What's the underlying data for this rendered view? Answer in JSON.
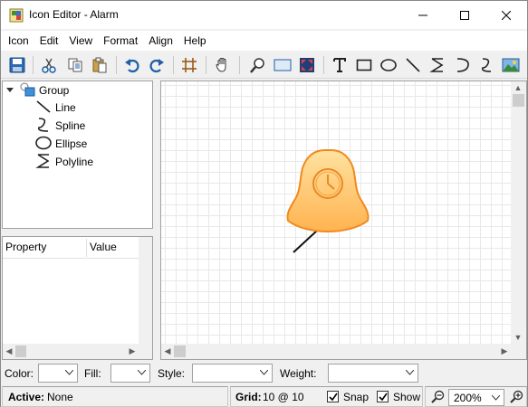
{
  "window": {
    "title": "Icon Editor - Alarm",
    "minimize_label": "Minimize",
    "maximize_label": "Maximize",
    "close_label": "Close"
  },
  "menu": {
    "items": [
      {
        "label": "Icon"
      },
      {
        "label": "Edit"
      },
      {
        "label": "View"
      },
      {
        "label": "Format"
      },
      {
        "label": "Align"
      },
      {
        "label": "Help"
      }
    ]
  },
  "toolbar": {
    "tools": [
      "save-icon",
      "cut-icon",
      "copy-icon",
      "paste-icon",
      "undo-icon",
      "redo-icon",
      "grid-icon",
      "pan-hand-icon",
      "zoom-icon",
      "select-rect-icon",
      "fit-icon",
      "text-icon",
      "rectangle-icon",
      "ellipse-icon",
      "line-icon",
      "polyline-icon",
      "arc-icon",
      "spline-icon",
      "image-icon"
    ]
  },
  "tree": {
    "root": {
      "label": "Group",
      "icon": "group-icon"
    },
    "children": [
      {
        "label": "Line",
        "icon": "line-shape-icon"
      },
      {
        "label": "Spline",
        "icon": "spline-shape-icon"
      },
      {
        "label": "Ellipse",
        "icon": "ellipse-shape-icon"
      },
      {
        "label": "Polyline",
        "icon": "polyline-shape-icon"
      }
    ]
  },
  "properties": {
    "col_property": "Property",
    "col_value": "Value"
  },
  "propbar": {
    "color_label": "Color:",
    "fill_label": "Fill:",
    "style_label": "Style:",
    "weight_label": "Weight:",
    "color_value": "",
    "fill_value": "",
    "style_value": "",
    "weight_value": ""
  },
  "status": {
    "active_label": "Active:",
    "active_value": "None",
    "grid_label": "Grid:",
    "grid_value": "10 @ 10",
    "snap_label": "Snap",
    "snap_checked": true,
    "show_label": "Show",
    "show_checked": true,
    "zoom_value": "200%"
  },
  "colors": {
    "bell_fill": "#ffc46e",
    "bell_stroke": "#f08a20",
    "accent_blue": "#1e5fa8"
  }
}
